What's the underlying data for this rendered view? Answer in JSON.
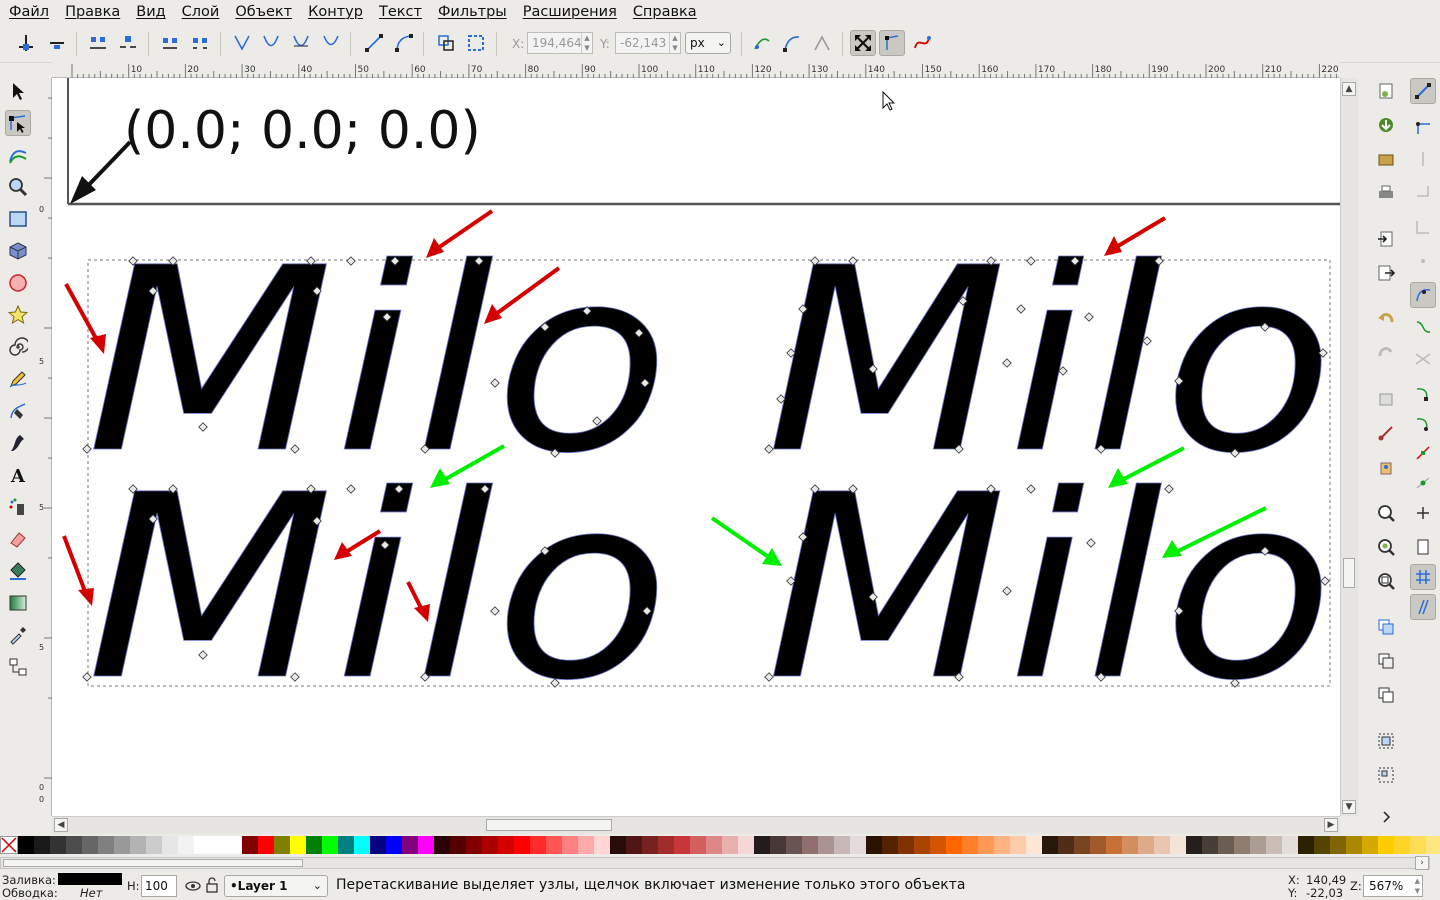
{
  "menu": [
    "Файл",
    "Правка",
    "Вид",
    "Слой",
    "Объект",
    "Контур",
    "Текст",
    "Фильтры",
    "Расширения",
    "Справка"
  ],
  "toolbar": {
    "x_label": "X:",
    "x_value": "194,464",
    "y_label": "Y:",
    "y_value": "-62,143",
    "unit": "px"
  },
  "ruler": {
    "h_ticks": [
      "10",
      "20",
      "30",
      "40",
      "50",
      "60",
      "70",
      "80",
      "90",
      "100",
      "110",
      "120",
      "130",
      "140",
      "150",
      "160",
      "170",
      "180",
      "190",
      "200",
      "210",
      "220"
    ],
    "v_ticks": [
      "0",
      "5",
      "5",
      "5",
      "0",
      "0"
    ]
  },
  "canvas": {
    "origin_label": "(0.0; 0.0; 0.0)",
    "words": [
      "Milo",
      "Milo",
      "Milo",
      "Milo"
    ]
  },
  "status": {
    "fill_label": "Заливка:",
    "stroke_label": "Обводка:",
    "stroke_value": "Нет",
    "h_label": "H:",
    "h_value": "100",
    "layer": "•Layer 1",
    "message": "Перетаскивание выделяет узлы, щелчок включает изменение только этого объекта",
    "cursor_x_label": "X:",
    "cursor_x": "140,49",
    "cursor_y_label": "Y:",
    "cursor_y": "-22,03",
    "zoom_label": "Z:",
    "zoom": "567%"
  },
  "colors": {
    "arrow_red": "#d40000",
    "arrow_green": "#00ee00",
    "accent_blue": "#2a6dd8"
  }
}
